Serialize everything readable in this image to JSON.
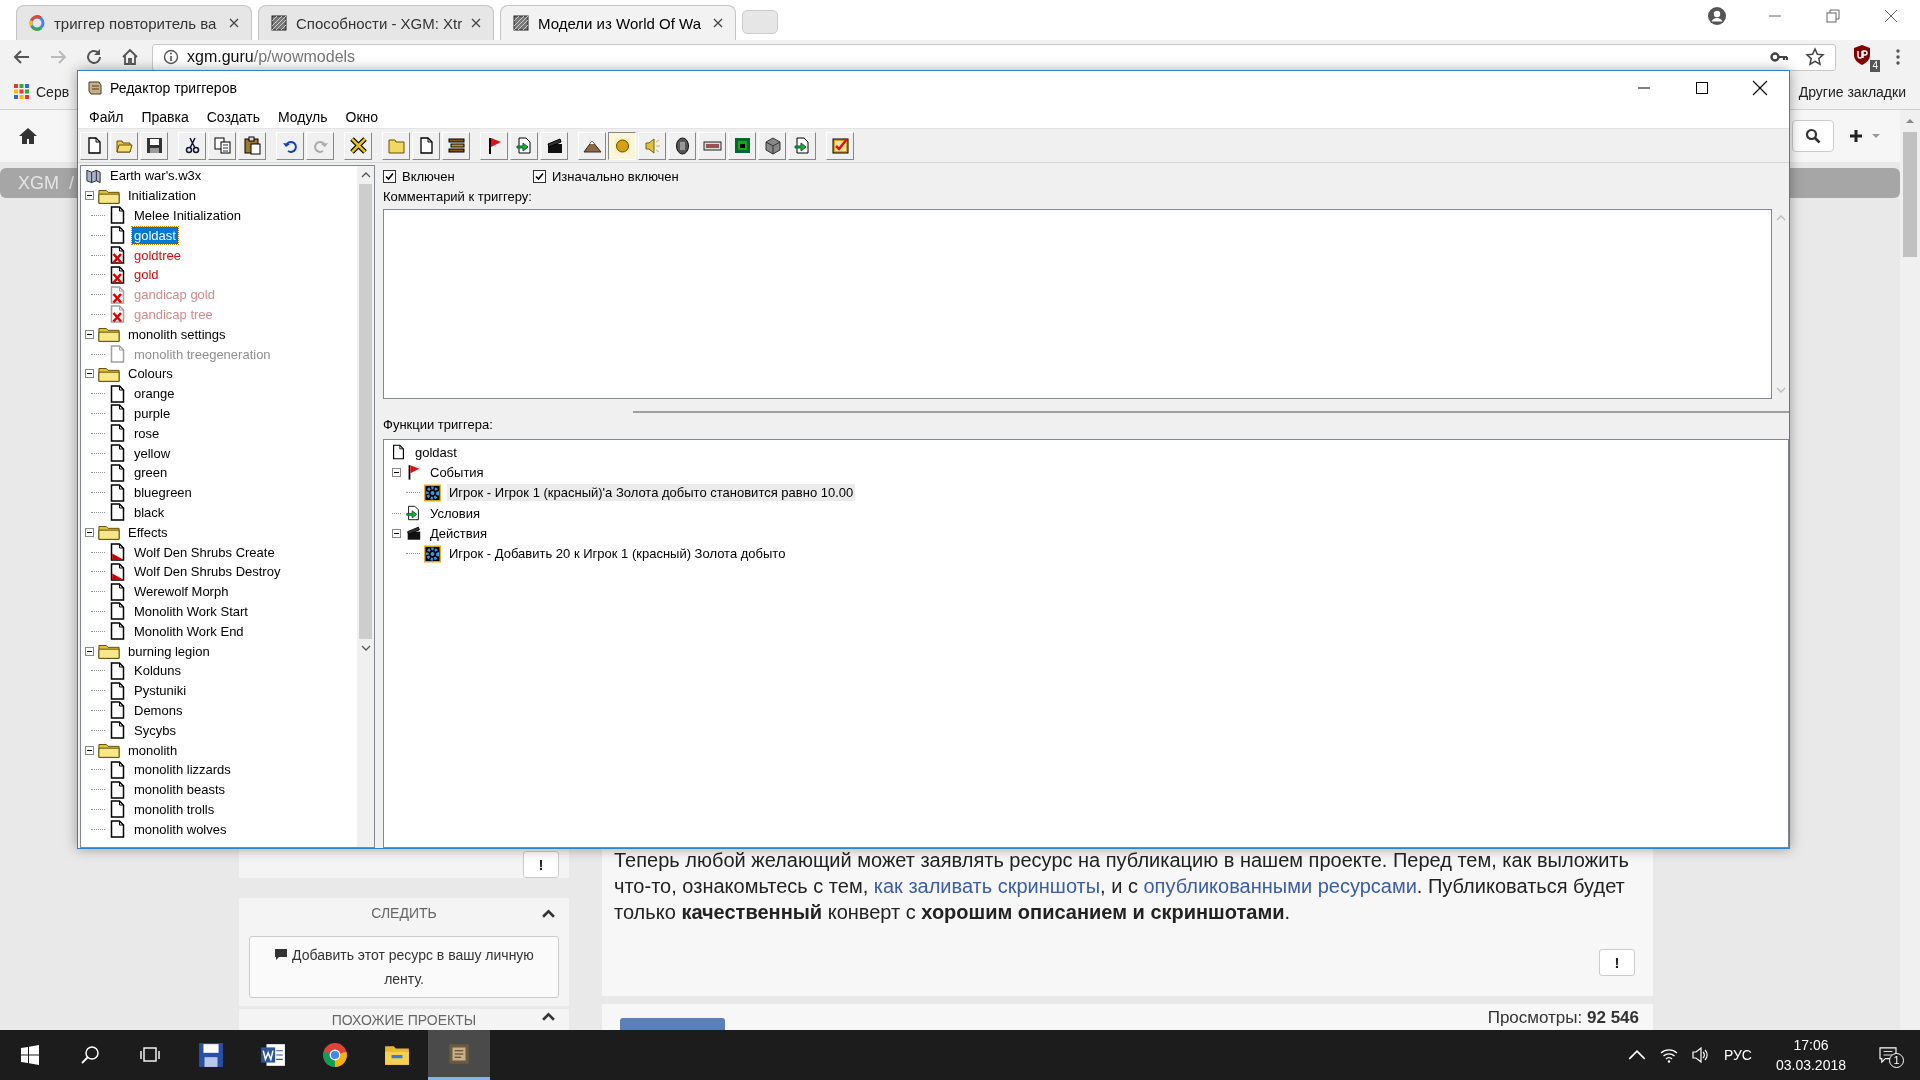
{
  "browser": {
    "tabs": [
      {
        "title": "триггер повторитель ва",
        "kind": "search",
        "selected": false
      },
      {
        "title": "Способности - XGM: Xtr",
        "kind": "site",
        "selected": false
      },
      {
        "title": "Модели из World Of Wa",
        "kind": "site",
        "selected": true
      }
    ],
    "address": {
      "host": "xgm.guru",
      "path": "/p/wowmodels"
    },
    "extension_badge": "4",
    "bookmarks": [
      "Серв"
    ],
    "other_bookmarks": "Другие закладки"
  },
  "page": {
    "breadcrumb": [
      "XGM",
      "/"
    ],
    "sidebar": {
      "report_button": "!",
      "follow_title": "СЛЕДИТЬ",
      "follow_button": "Добавить этот ресурс в вашу личную ленту.",
      "similar_title": "ПОХОЖИЕ ПРОЕКТЫ"
    },
    "notice": [
      {
        "kind": "text",
        "text": "Теперь любой желающий может заявлять ресурс на публикацию в нашем проекте. Перед тем, как выложить что-то, ознакомьтесь с тем, "
      },
      {
        "kind": "link",
        "text": "как заливать скриншоты"
      },
      {
        "kind": "text",
        "text": ", и с "
      },
      {
        "kind": "link",
        "text": "опубликованными ресурсами"
      },
      {
        "kind": "text",
        "text": ". Публиковаться будет только **качественный** конверт с **хорошим описанием и скриншотами**."
      }
    ],
    "report_button": "!",
    "views": "Просмотры: **92 546**"
  },
  "dialog": {
    "title": "Редактор триггеров",
    "menu": [
      "Файл",
      "Правка",
      "Создать",
      "Модуль",
      "Окно"
    ],
    "tree": {
      "root": "Earth war's.w3x",
      "folders": [
        {
          "label": "Initialization",
          "expanded": true,
          "children": [
            {
              "label": "Melee Initialization",
              "enabled": true,
              "error": false,
              "initially_on": true,
              "selected": false
            },
            {
              "label": "goldast",
              "enabled": true,
              "error": false,
              "initially_on": true,
              "selected": true
            },
            {
              "label": "goldtree",
              "enabled": true,
              "error": true,
              "initially_on": true,
              "selected": false
            },
            {
              "label": "gold",
              "enabled": true,
              "error": true,
              "initially_on": true,
              "selected": false
            },
            {
              "label": "gandicap gold",
              "enabled": false,
              "error": true,
              "initially_on": true,
              "selected": false
            },
            {
              "label": "gandicap tree",
              "enabled": false,
              "error": true,
              "initially_on": true,
              "selected": false
            }
          ]
        },
        {
          "label": "monolith settings",
          "expanded": true,
          "children": [
            {
              "label": "monolith treegeneration",
              "enabled": false,
              "error": false,
              "initially_on": true,
              "selected": false
            }
          ]
        },
        {
          "label": "Colours",
          "expanded": true,
          "children": [
            {
              "label": "orange",
              "enabled": true,
              "error": false,
              "initially_on": true,
              "selected": false
            },
            {
              "label": "purple",
              "enabled": true,
              "error": false,
              "initially_on": true,
              "selected": false
            },
            {
              "label": "rose",
              "enabled": true,
              "error": false,
              "initially_on": true,
              "selected": false
            },
            {
              "label": "yellow",
              "enabled": true,
              "error": false,
              "initially_on": true,
              "selected": false
            },
            {
              "label": "green",
              "enabled": true,
              "error": false,
              "initially_on": true,
              "selected": false
            },
            {
              "label": "bluegreen",
              "enabled": true,
              "error": false,
              "initially_on": true,
              "selected": false
            },
            {
              "label": "black",
              "enabled": true,
              "error": false,
              "initially_on": true,
              "selected": false
            }
          ]
        },
        {
          "label": "Effects",
          "expanded": true,
          "children": [
            {
              "label": "Wolf Den Shrubs Create",
              "enabled": true,
              "error": false,
              "initially_on": false,
              "selected": false
            },
            {
              "label": "Wolf Den Shrubs Destroy",
              "enabled": true,
              "error": false,
              "initially_on": false,
              "selected": false
            },
            {
              "label": "Werewolf Morph",
              "enabled": true,
              "error": false,
              "initially_on": true,
              "selected": false
            },
            {
              "label": "Monolith Work Start",
              "enabled": true,
              "error": false,
              "initially_on": true,
              "selected": false
            },
            {
              "label": "Monolith Work End",
              "enabled": true,
              "error": false,
              "initially_on": true,
              "selected": false
            }
          ]
        },
        {
          "label": "burning legion",
          "expanded": true,
          "children": [
            {
              "label": "Kolduns",
              "enabled": true,
              "error": false,
              "initially_on": true,
              "selected": false
            },
            {
              "label": "Pystuniki",
              "enabled": true,
              "error": false,
              "initially_on": true,
              "selected": false
            },
            {
              "label": "Demons",
              "enabled": true,
              "error": false,
              "initially_on": true,
              "selected": false
            },
            {
              "label": "Sycybs",
              "enabled": true,
              "error": false,
              "initially_on": true,
              "selected": false
            }
          ]
        },
        {
          "label": "monolith",
          "expanded": true,
          "children": [
            {
              "label": "monolith lizzards",
              "enabled": true,
              "error": false,
              "initially_on": true,
              "selected": false
            },
            {
              "label": "monolith beasts",
              "enabled": true,
              "error": false,
              "initially_on": true,
              "selected": false
            },
            {
              "label": "monolith trolls",
              "enabled": true,
              "error": false,
              "initially_on": true,
              "selected": false
            },
            {
              "label": "monolith wolves",
              "enabled": true,
              "error": false,
              "initially_on": true,
              "selected": false
            }
          ]
        }
      ]
    },
    "options": [
      {
        "label": "Включен",
        "checked": true
      },
      {
        "label": "Изначально включен",
        "checked": true
      }
    ],
    "comment_label": "Комментарий к триггеру:",
    "functions_label": "Функции триггера:",
    "functions": {
      "trigger": "goldast",
      "sections": [
        {
          "label": "События",
          "kind": "events",
          "expanded": true,
          "children": [
            {
              "label": "Игрок - Игрок 1 (красный)'а Золота добыто становится равно 10.00",
              "selected": true
            }
          ]
        },
        {
          "label": "Условия",
          "kind": "conditions"
        },
        {
          "label": "Действия",
          "kind": "actions",
          "expanded": true,
          "children": [
            {
              "label": "Игрок - Добавить 20 к Игрок 1 (красный) Золота добыто",
              "selected": false
            }
          ]
        }
      ]
    }
  },
  "taskbar": {
    "language": "РУС",
    "time": "17:06",
    "date": "03.03.2018",
    "notifications": "1"
  }
}
